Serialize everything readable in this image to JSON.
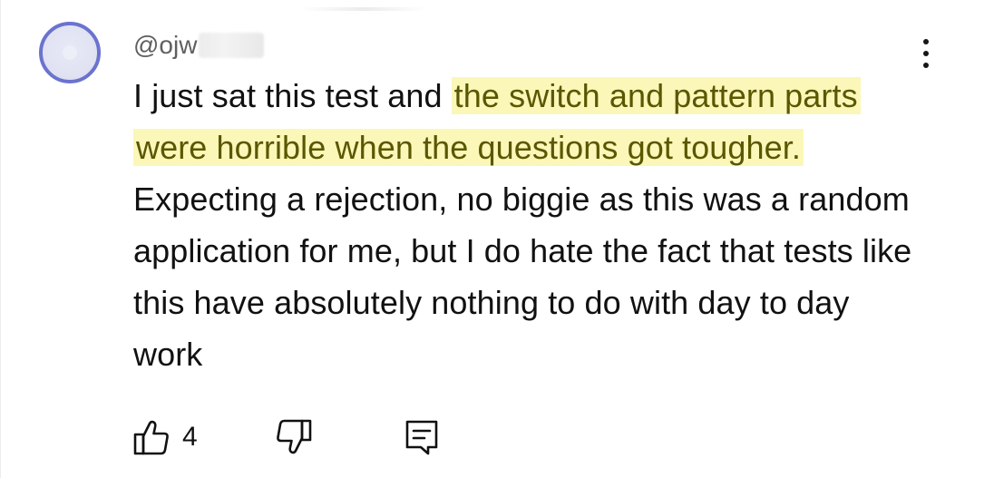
{
  "comment": {
    "username": "@ojw",
    "segments": [
      {
        "text": "I just sat this test and ",
        "highlight": false
      },
      {
        "text": "the switch and pattern parts were horrible when the questions got tougher.",
        "highlight": true
      },
      {
        "text": " Expecting a rejection, no biggie as this was a random application for me, but I do hate the fact that tests like this have absolutely nothing to do with day to day work",
        "highlight": false
      }
    ]
  },
  "actions": {
    "like_count": "4",
    "like_icon": "thumbs-up-icon",
    "dislike_icon": "thumbs-down-icon",
    "reply_icon": "comment-reply-icon",
    "more_icon": "more-vertical-icon"
  },
  "colors": {
    "highlight_bg": "#fbf7b8",
    "highlight_text": "#5a5700",
    "avatar_ring": "#6b73cf",
    "username": "#5f5f5f"
  }
}
